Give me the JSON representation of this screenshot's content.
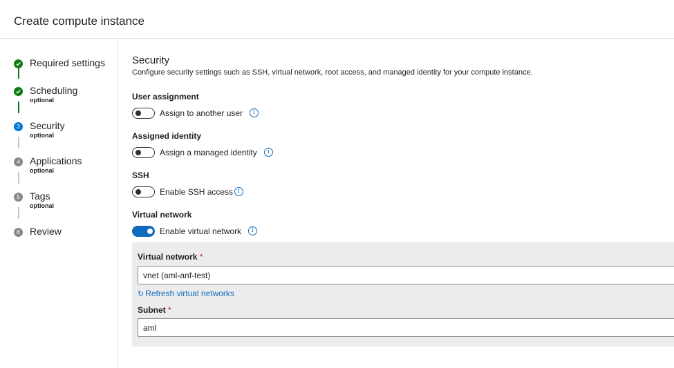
{
  "header": {
    "title": "Create compute instance"
  },
  "steps": [
    {
      "label": "Required settings",
      "sub": "",
      "state": "done"
    },
    {
      "label": "Scheduling",
      "sub": "optional",
      "state": "done"
    },
    {
      "label": "Security",
      "sub": "optional",
      "state": "current",
      "number": "3"
    },
    {
      "label": "Applications",
      "sub": "optional",
      "state": "pending",
      "number": "4"
    },
    {
      "label": "Tags",
      "sub": "optional",
      "state": "pending",
      "number": "5"
    },
    {
      "label": "Review",
      "sub": "",
      "state": "pending",
      "number": "6"
    }
  ],
  "section": {
    "title": "Security",
    "description": "Configure security settings such as SSH, virtual network, root access, and managed identity for your compute instance."
  },
  "groups": {
    "user_assignment": {
      "label": "User assignment",
      "toggle_label": "Assign to another user",
      "on": false
    },
    "assigned_identity": {
      "label": "Assigned identity",
      "toggle_label": "Assign a managed identity",
      "on": false
    },
    "ssh": {
      "label": "SSH",
      "toggle_label": "Enable SSH access",
      "on": false
    },
    "virtual_network": {
      "label": "Virtual network",
      "toggle_label": "Enable virtual network",
      "on": true
    }
  },
  "vnet_panel": {
    "vnet_label": "Virtual network",
    "vnet_value": "vnet (aml-anf-test)",
    "refresh_label": "Refresh virtual networks",
    "subnet_label": "Subnet",
    "subnet_value": "aml",
    "required_marker": "*"
  },
  "icons": {
    "info": "i",
    "refresh": "↻"
  },
  "colors": {
    "done": "#107c10",
    "current": "#0078d4",
    "pending": "#8a8886",
    "accent": "#0f6cbd",
    "required": "#a4262c"
  }
}
